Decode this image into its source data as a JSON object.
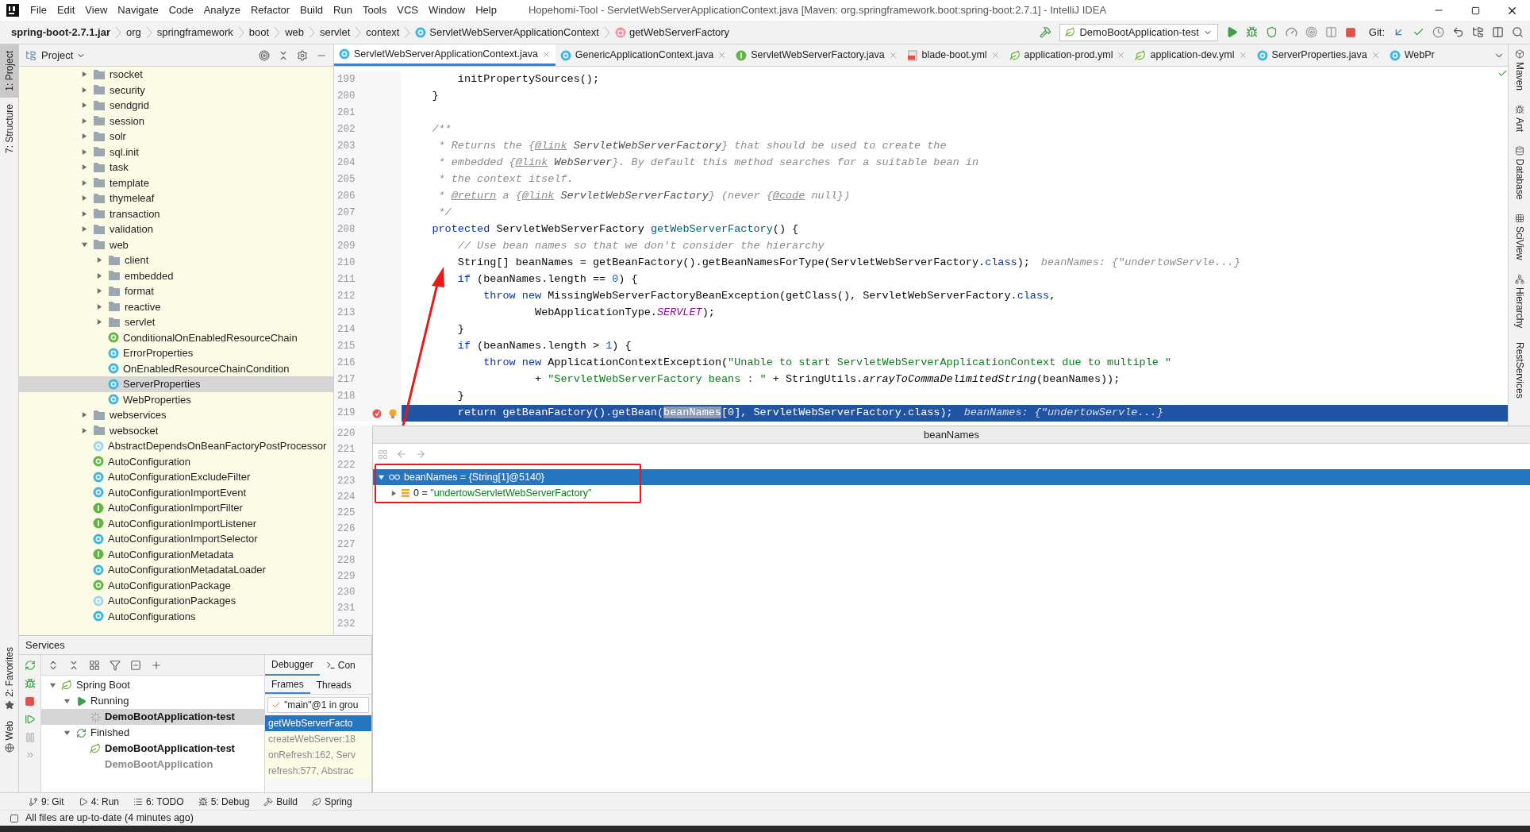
{
  "window": {
    "title": "Hopehomi-Tool - ServletWebServerApplicationContext.java [Maven: org.springframework.boot:spring-boot:2.7.1] - IntelliJ IDEA"
  },
  "menu": [
    "File",
    "Edit",
    "View",
    "Navigate",
    "Code",
    "Analyze",
    "Refactor",
    "Build",
    "Run",
    "Tools",
    "VCS",
    "Window",
    "Help"
  ],
  "breadcrumbs": [
    {
      "label": "spring-boot-2.7.1.jar",
      "kind": "jar"
    },
    {
      "label": "org",
      "kind": "package"
    },
    {
      "label": "springframework",
      "kind": "package"
    },
    {
      "label": "boot",
      "kind": "package"
    },
    {
      "label": "web",
      "kind": "package"
    },
    {
      "label": "servlet",
      "kind": "package"
    },
    {
      "label": "context",
      "kind": "package"
    },
    {
      "label": "ServletWebServerApplicationContext",
      "kind": "class"
    },
    {
      "label": "getWebServerFactory",
      "kind": "method"
    }
  ],
  "run_config": {
    "label": "DemoBootApplication-test"
  },
  "git": {
    "label": "Git:"
  },
  "left_tools": [
    {
      "label": "1: Project",
      "selected": true
    },
    {
      "label": "7: Structure",
      "selected": false
    }
  ],
  "left_tools_bottom": [
    {
      "label": "2: Favorites",
      "kind": "favorites"
    },
    {
      "label": "Web",
      "kind": "web"
    }
  ],
  "project": {
    "title": "Project",
    "tree": [
      {
        "label": "rsocket",
        "kind": "folder",
        "expanded": false,
        "selected": false
      },
      {
        "label": "security",
        "kind": "folder",
        "expanded": false,
        "selected": false
      },
      {
        "label": "sendgrid",
        "kind": "folder",
        "expanded": false,
        "selected": false
      },
      {
        "label": "session",
        "kind": "folder",
        "expanded": false,
        "selected": false
      },
      {
        "label": "solr",
        "kind": "folder",
        "expanded": false,
        "selected": false
      },
      {
        "label": "sql.init",
        "kind": "folder",
        "expanded": false,
        "selected": false
      },
      {
        "label": "task",
        "kind": "folder",
        "expanded": false,
        "selected": false
      },
      {
        "label": "template",
        "kind": "folder",
        "expanded": false,
        "selected": false
      },
      {
        "label": "thymeleaf",
        "kind": "folder",
        "expanded": false,
        "selected": false
      },
      {
        "label": "transaction",
        "kind": "folder",
        "expanded": false,
        "selected": false
      },
      {
        "label": "validation",
        "kind": "folder",
        "expanded": false,
        "selected": false
      },
      {
        "label": "web",
        "kind": "folder",
        "expanded": true,
        "selected": false,
        "children": [
          {
            "label": "client",
            "kind": "folder",
            "expanded": false,
            "selected": false
          },
          {
            "label": "embedded",
            "kind": "folder",
            "expanded": false,
            "selected": false
          },
          {
            "label": "format",
            "kind": "folder",
            "expanded": false,
            "selected": false
          },
          {
            "label": "reactive",
            "kind": "folder",
            "expanded": false,
            "selected": false
          },
          {
            "label": "servlet",
            "kind": "folder",
            "expanded": false,
            "selected": false
          },
          {
            "label": "ConditionalOnEnabledResourceChain",
            "kind": "annotation",
            "selected": false
          },
          {
            "label": "ErrorProperties",
            "kind": "class",
            "selected": false
          },
          {
            "label": "OnEnabledResourceChainCondition",
            "kind": "class",
            "selected": false
          },
          {
            "label": "ServerProperties",
            "kind": "class",
            "selected": true
          },
          {
            "label": "WebProperties",
            "kind": "class",
            "selected": false
          }
        ]
      },
      {
        "label": "webservices",
        "kind": "folder",
        "expanded": false,
        "selected": false
      },
      {
        "label": "websocket",
        "kind": "folder",
        "expanded": false,
        "selected": false
      },
      {
        "label": "AbstractDependsOnBeanFactoryPostProcessor",
        "kind": "abstract",
        "selected": false
      },
      {
        "label": "AutoConfiguration",
        "kind": "annotation",
        "selected": false
      },
      {
        "label": "AutoConfigurationExcludeFilter",
        "kind": "class",
        "selected": false
      },
      {
        "label": "AutoConfigurationImportEvent",
        "kind": "class",
        "selected": false
      },
      {
        "label": "AutoConfigurationImportFilter",
        "kind": "interface",
        "selected": false
      },
      {
        "label": "AutoConfigurationImportListener",
        "kind": "interface",
        "selected": false
      },
      {
        "label": "AutoConfigurationImportSelector",
        "kind": "class",
        "selected": false
      },
      {
        "label": "AutoConfigurationMetadata",
        "kind": "interface",
        "selected": false
      },
      {
        "label": "AutoConfigurationMetadataLoader",
        "kind": "class",
        "selected": false
      },
      {
        "label": "AutoConfigurationPackage",
        "kind": "annotation",
        "selected": false
      },
      {
        "label": "AutoConfigurationPackages",
        "kind": "abstract",
        "selected": false
      },
      {
        "label": "AutoConfigurations",
        "kind": "class",
        "selected": false
      }
    ]
  },
  "tabs": [
    {
      "label": "ServletWebServerApplicationContext.java",
      "kind": "class",
      "selected": true,
      "closable": true
    },
    {
      "label": "GenericApplicationContext.java",
      "kind": "class",
      "selected": false,
      "closable": true
    },
    {
      "label": "ServletWebServerFactory.java",
      "kind": "interface",
      "selected": false,
      "closable": true
    },
    {
      "label": "blade-boot.yml",
      "kind": "yml",
      "selected": false,
      "closable": true
    },
    {
      "label": "application-prod.yml",
      "kind": "spring",
      "selected": false,
      "closable": true
    },
    {
      "label": "application-dev.yml",
      "kind": "spring",
      "selected": false,
      "closable": true
    },
    {
      "label": "ServerProperties.java",
      "kind": "class",
      "selected": false,
      "closable": true
    },
    {
      "label": "WebPr",
      "kind": "class",
      "selected": false,
      "closable": false
    }
  ],
  "code": {
    "lines": [
      {
        "number": "199",
        "current": false,
        "breakpoint": false,
        "tokens": [
          {
            "kind": "plain",
            "text": "        initPropertySources();"
          }
        ]
      },
      {
        "number": "200",
        "current": false,
        "breakpoint": false,
        "tokens": [
          {
            "kind": "plain",
            "text": "    }"
          }
        ]
      },
      {
        "number": "201",
        "current": false,
        "breakpoint": false
      },
      {
        "number": "202",
        "current": false,
        "breakpoint": false,
        "tokens": [
          {
            "kind": "comment",
            "text": "    /**"
          }
        ]
      },
      {
        "number": "203",
        "current": false,
        "breakpoint": false,
        "tokens": [
          {
            "kind": "comment",
            "text": "     * Returns the {"
          },
          {
            "kind": "doctag",
            "text": "@link"
          },
          {
            "kind": "doclink",
            "text": " ServletWebServerFactory"
          },
          {
            "kind": "comment",
            "text": "} that should be used to create the"
          }
        ]
      },
      {
        "number": "204",
        "current": false,
        "breakpoint": false,
        "tokens": [
          {
            "kind": "comment",
            "text": "     * embedded {"
          },
          {
            "kind": "doctag",
            "text": "@link"
          },
          {
            "kind": "doclink",
            "text": " WebServer"
          },
          {
            "kind": "comment",
            "text": "}. By default this method searches for a suitable bean in"
          }
        ]
      },
      {
        "number": "205",
        "current": false,
        "breakpoint": false,
        "tokens": [
          {
            "kind": "comment",
            "text": "     * the context itself."
          }
        ]
      },
      {
        "number": "206",
        "current": false,
        "breakpoint": false,
        "tokens": [
          {
            "kind": "comment",
            "text": "     * "
          },
          {
            "kind": "doctag",
            "text": "@return"
          },
          {
            "kind": "comment",
            "text": " a {"
          },
          {
            "kind": "doctag",
            "text": "@link"
          },
          {
            "kind": "doclink",
            "text": " ServletWebServerFactory"
          },
          {
            "kind": "comment",
            "text": "} (never {"
          },
          {
            "kind": "doctag",
            "text": "@code"
          },
          {
            "kind": "comment",
            "text": " null})"
          }
        ]
      },
      {
        "number": "207",
        "current": false,
        "breakpoint": false,
        "tokens": [
          {
            "kind": "comment",
            "text": "     */"
          }
        ]
      },
      {
        "number": "208",
        "current": false,
        "breakpoint": false,
        "tokens": [
          {
            "kind": "keyword",
            "text": "    protected"
          },
          {
            "kind": "plain",
            "text": " ServletWebServerFactory "
          },
          {
            "kind": "method",
            "text": "getWebServerFactory"
          },
          {
            "kind": "plain",
            "text": "() {"
          }
        ]
      },
      {
        "number": "209",
        "current": false,
        "breakpoint": false,
        "tokens": [
          {
            "kind": "comment",
            "text": "        // Use bean names so that we don't consider the hierarchy"
          }
        ]
      },
      {
        "number": "210",
        "current": false,
        "breakpoint": false,
        "tokens": [
          {
            "kind": "plain",
            "text": "        String[] beanNames = getBeanFactory().getBeanNamesForType(ServletWebServerFactory."
          },
          {
            "kind": "keyword",
            "text": "class"
          },
          {
            "kind": "plain",
            "text": ");"
          }
        ],
        "hint": "beanNames: {\"undertowServle...}"
      },
      {
        "number": "211",
        "current": false,
        "breakpoint": false,
        "tokens": [
          {
            "kind": "keyword",
            "text": "        if"
          },
          {
            "kind": "plain",
            "text": " (beanNames.length == "
          },
          {
            "kind": "number",
            "text": "0"
          },
          {
            "kind": "plain",
            "text": ") {"
          }
        ]
      },
      {
        "number": "212",
        "current": false,
        "breakpoint": false,
        "tokens": [
          {
            "kind": "keyword",
            "text": "            throw new"
          },
          {
            "kind": "plain",
            "text": " MissingWebServerFactoryBeanException(getClass(), ServletWebServerFactory."
          },
          {
            "kind": "keyword",
            "text": "class"
          },
          {
            "kind": "plain",
            "text": ","
          }
        ]
      },
      {
        "number": "213",
        "current": false,
        "breakpoint": false,
        "tokens": [
          {
            "kind": "plain",
            "text": "                    WebApplicationType."
          },
          {
            "kind": "constant",
            "text": "SERVLET"
          },
          {
            "kind": "plain",
            "text": ");"
          }
        ]
      },
      {
        "number": "214",
        "current": false,
        "breakpoint": false,
        "tokens": [
          {
            "kind": "plain",
            "text": "        }"
          }
        ]
      },
      {
        "number": "215",
        "current": false,
        "breakpoint": false,
        "tokens": [
          {
            "kind": "keyword",
            "text": "        if"
          },
          {
            "kind": "plain",
            "text": " (beanNames.length > "
          },
          {
            "kind": "number",
            "text": "1"
          },
          {
            "kind": "plain",
            "text": ") {"
          }
        ]
      },
      {
        "number": "216",
        "current": false,
        "breakpoint": false,
        "tokens": [
          {
            "kind": "keyword",
            "text": "            throw new"
          },
          {
            "kind": "plain",
            "text": " ApplicationContextException("
          },
          {
            "kind": "string",
            "text": "\"Unable to start ServletWebServerApplicationContext due to multiple \""
          }
        ]
      },
      {
        "number": "217",
        "current": false,
        "breakpoint": false,
        "tokens": [
          {
            "kind": "plain",
            "text": "                    + "
          },
          {
            "kind": "string",
            "text": "\"ServletWebServerFactory beans : \""
          },
          {
            "kind": "plain",
            "text": " + StringUtils."
          },
          {
            "kind": "static",
            "text": "arrayToCommaDelimitedString"
          },
          {
            "kind": "plain",
            "text": "(beanNames));"
          }
        ]
      },
      {
        "number": "218",
        "current": false,
        "breakpoint": false,
        "tokens": [
          {
            "kind": "plain",
            "text": "        }"
          }
        ]
      },
      {
        "number": "219",
        "current": true,
        "breakpoint": true,
        "tokens": [
          {
            "kind": "keyword",
            "text": "        return"
          },
          {
            "kind": "plain",
            "text": " getBeanFactory().getBean("
          },
          {
            "kind": "selection",
            "text": "beanNames"
          },
          {
            "kind": "plain",
            "text": "[0], ServletWebServerFactory."
          },
          {
            "kind": "keyword",
            "text": "class"
          },
          {
            "kind": "plain",
            "text": ");"
          }
        ],
        "hint": "beanNames: {\"undertowServle...}"
      }
    ],
    "more_line_numbers": [
      "220",
      "221",
      "222",
      "223",
      "224",
      "225",
      "226",
      "227",
      "228",
      "229",
      "230",
      "231",
      "232"
    ]
  },
  "right_tools": [
    {
      "label": "Maven",
      "kind": "maven"
    },
    {
      "label": "Ant",
      "kind": "ant"
    },
    {
      "label": "Database",
      "kind": "database"
    },
    {
      "label": "SciView",
      "kind": "sciview"
    },
    {
      "label": "Hierarchy",
      "kind": "hierarchy"
    },
    {
      "label": "RestServices",
      "kind": "rest"
    }
  ],
  "debug_panel": {
    "title": "beanNames",
    "variables": [
      {
        "label": "beanNames = {String[1]@5140}",
        "expanded": true,
        "selected": true,
        "children": [
          {
            "label": "0 = ",
            "value": "\"undertowServletWebServerFactory\"",
            "expanded": false,
            "selected": false
          }
        ]
      }
    ]
  },
  "services": {
    "title": "Services",
    "tree": [
      {
        "label": "Spring Boot",
        "kind": "root",
        "expanded": true,
        "selected": false,
        "children": [
          {
            "label": "Running",
            "kind": "running",
            "expanded": true,
            "selected": false,
            "children": [
              {
                "label": "DemoBootApplication-test",
                "kind": "app-running",
                "selected": true
              }
            ]
          },
          {
            "label": "Finished",
            "kind": "finished",
            "expanded": true,
            "selected": false,
            "children": [
              {
                "label": "DemoBootApplication-test",
                "kind": "app-finished",
                "selected": false
              },
              {
                "label": "DemoBootApplication",
                "kind": "app-inactive",
                "selected": false
              }
            ]
          }
        ]
      }
    ],
    "debugger_tabs": [
      {
        "label": "Debugger",
        "selected": true
      },
      {
        "label": "Con",
        "selected": false
      }
    ],
    "frame_tabs": [
      {
        "label": "Frames",
        "selected": true
      },
      {
        "label": "Threads",
        "selected": false
      }
    ],
    "thread": "\"main\"@1 in grou",
    "frames": [
      {
        "label": "getWebServerFacto",
        "selected": true
      },
      {
        "label": "createWebServer:18",
        "selected": false
      },
      {
        "label": "onRefresh:162, Serv",
        "selected": false
      },
      {
        "label": "refresh:577, Abstrac",
        "selected": false
      }
    ]
  },
  "bottom_tools": [
    {
      "label": "9: Git",
      "kind": "git"
    },
    {
      "label": "4: Run",
      "kind": "run"
    },
    {
      "label": "6: TODO",
      "kind": "todo"
    },
    {
      "label": "5: Debug",
      "kind": "debug"
    },
    {
      "label": "Build",
      "kind": "build"
    },
    {
      "label": "Spring",
      "kind": "spring"
    }
  ],
  "status_bar": {
    "text": "All files are up-to-date (4 minutes ago)"
  }
}
